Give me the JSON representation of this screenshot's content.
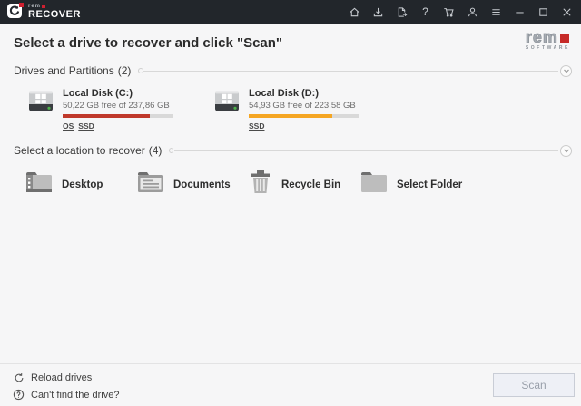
{
  "titlebar": {
    "wordmark_prefix": "rem",
    "product": "RECOVER",
    "icons": [
      "home",
      "install",
      "file-export",
      "help",
      "cart",
      "account",
      "menu"
    ],
    "window_controls": [
      "minimize",
      "maximize",
      "close"
    ]
  },
  "header": {
    "title": "Select a drive to recover and click \"Scan\"",
    "logo": {
      "wordmark_prefix": "rem",
      "subtitle": "SOFTWARE"
    }
  },
  "sections": {
    "drives": {
      "title": "Drives and Partitions",
      "count": "(2)"
    },
    "locations": {
      "title": "Select a location to recover",
      "count": "(4)"
    }
  },
  "drives": [
    {
      "name": "Local Disk (C:)",
      "details": "50,22 GB free of 237,86 GB",
      "used_pct": 78.9,
      "bar_color": "#c0392b",
      "tags": [
        "OS",
        "SSD"
      ]
    },
    {
      "name": "Local Disk (D:)",
      "details": "54,93 GB free of 223,58 GB",
      "used_pct": 75.4,
      "bar_color": "#f5a623",
      "tags": [
        "SSD"
      ]
    }
  ],
  "locations": [
    {
      "label": "Desktop",
      "icon": "desktop-folder-icon"
    },
    {
      "label": "Documents",
      "icon": "documents-folder-icon"
    },
    {
      "label": "Recycle Bin",
      "icon": "recycle-bin-icon"
    },
    {
      "label": "Select Folder",
      "icon": "select-folder-icon"
    }
  ],
  "footer": {
    "reload_label": "Reload drives",
    "help_label": "Can't find the drive?",
    "scan_label": "Scan"
  },
  "colors": {
    "titlebar_bg": "#22262b",
    "accent_red": "#cf2030",
    "bar_red": "#c0392b",
    "bar_orange": "#f5a623",
    "content_bg": "#f6f6f7"
  }
}
